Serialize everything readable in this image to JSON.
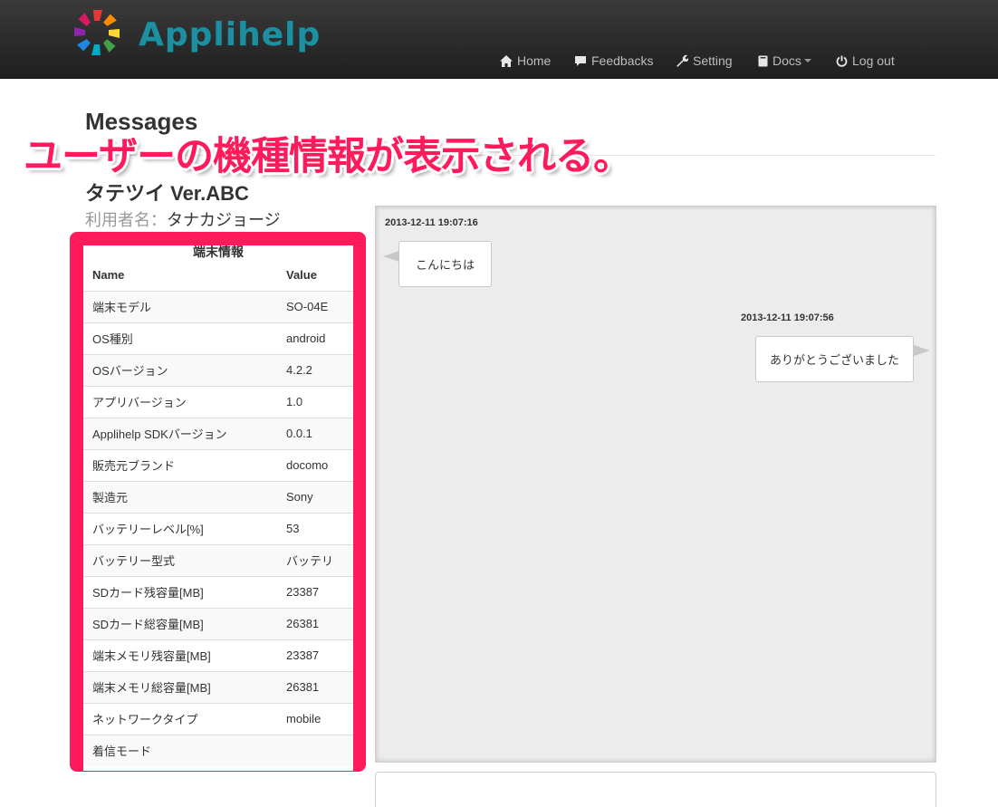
{
  "brand": {
    "name": "Applihelp"
  },
  "nav": {
    "items": [
      {
        "label": "Home",
        "icon": "home-icon"
      },
      {
        "label": "Feedbacks",
        "icon": "comment-icon"
      },
      {
        "label": "Setting",
        "icon": "wrench-icon"
      },
      {
        "label": "Docs",
        "icon": "book-icon"
      },
      {
        "label": "Log out",
        "icon": "power-icon"
      }
    ]
  },
  "page": {
    "title": "Messages",
    "annotation": "ユーザーの機種情報が表示される。",
    "app_name": "タテツイ Ver.ABC",
    "user_label": "利用者名：",
    "user_name": "タナカジョージ"
  },
  "device_info": {
    "caption": "端末情報",
    "headers": {
      "name": "Name",
      "value": "Value"
    },
    "rows": [
      {
        "name": "端末モデル",
        "value": "SO-04E"
      },
      {
        "name": "OS種別",
        "value": "android"
      },
      {
        "name": "OSバージョン",
        "value": "4.2.2"
      },
      {
        "name": "アプリバージョン",
        "value": "1.0"
      },
      {
        "name": "Applihelp SDKバージョン",
        "value": "0.0.1"
      },
      {
        "name": "販売元ブランド",
        "value": "docomo"
      },
      {
        "name": "製造元",
        "value": "Sony"
      },
      {
        "name": "バッテリーレベル[%]",
        "value": "53"
      },
      {
        "name": "バッテリー型式",
        "value": "バッテリ"
      },
      {
        "name": "SDカード残容量[MB]",
        "value": "23387"
      },
      {
        "name": "SDカード総容量[MB]",
        "value": "26381"
      },
      {
        "name": "端末メモリ残容量[MB]",
        "value": "23387"
      },
      {
        "name": "端末メモリ総容量[MB]",
        "value": "26381"
      },
      {
        "name": "ネットワークタイプ",
        "value": "mobile"
      },
      {
        "name": "着信モード",
        "value": ""
      }
    ]
  },
  "messages": [
    {
      "time": "2013-12-11 19:07:16",
      "text": "こんにちは",
      "side": "left"
    },
    {
      "time": "2013-12-11 19:07:56",
      "text": "ありがとうございました",
      "side": "right"
    }
  ],
  "colors": {
    "accent": "#ff1a5c",
    "brand": "#1e8fa0",
    "navbar": "#2a2a2a",
    "chat_bg": "#ececec"
  }
}
